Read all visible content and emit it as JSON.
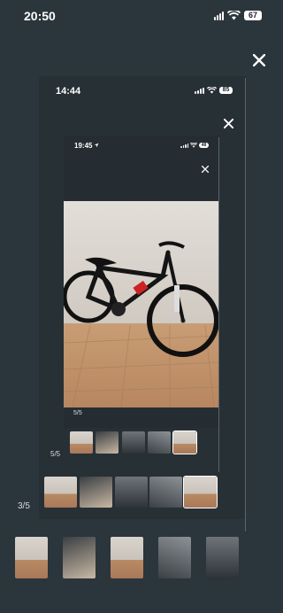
{
  "colors": {
    "background": "#2b353c",
    "panel": "#273035",
    "text": "#ffffff"
  },
  "level1": {
    "time": "20:50",
    "battery": "67",
    "counter": "3/5",
    "close_icon": "close-icon"
  },
  "level2": {
    "time": "14:44",
    "battery": "85",
    "counter": "5/5",
    "close_icon": "close-icon"
  },
  "level3": {
    "time": "19:45",
    "battery": "48",
    "counter": "5/5",
    "close_icon": "close-icon"
  },
  "photo": {
    "subject": "black mountain bike on tiled patio"
  }
}
